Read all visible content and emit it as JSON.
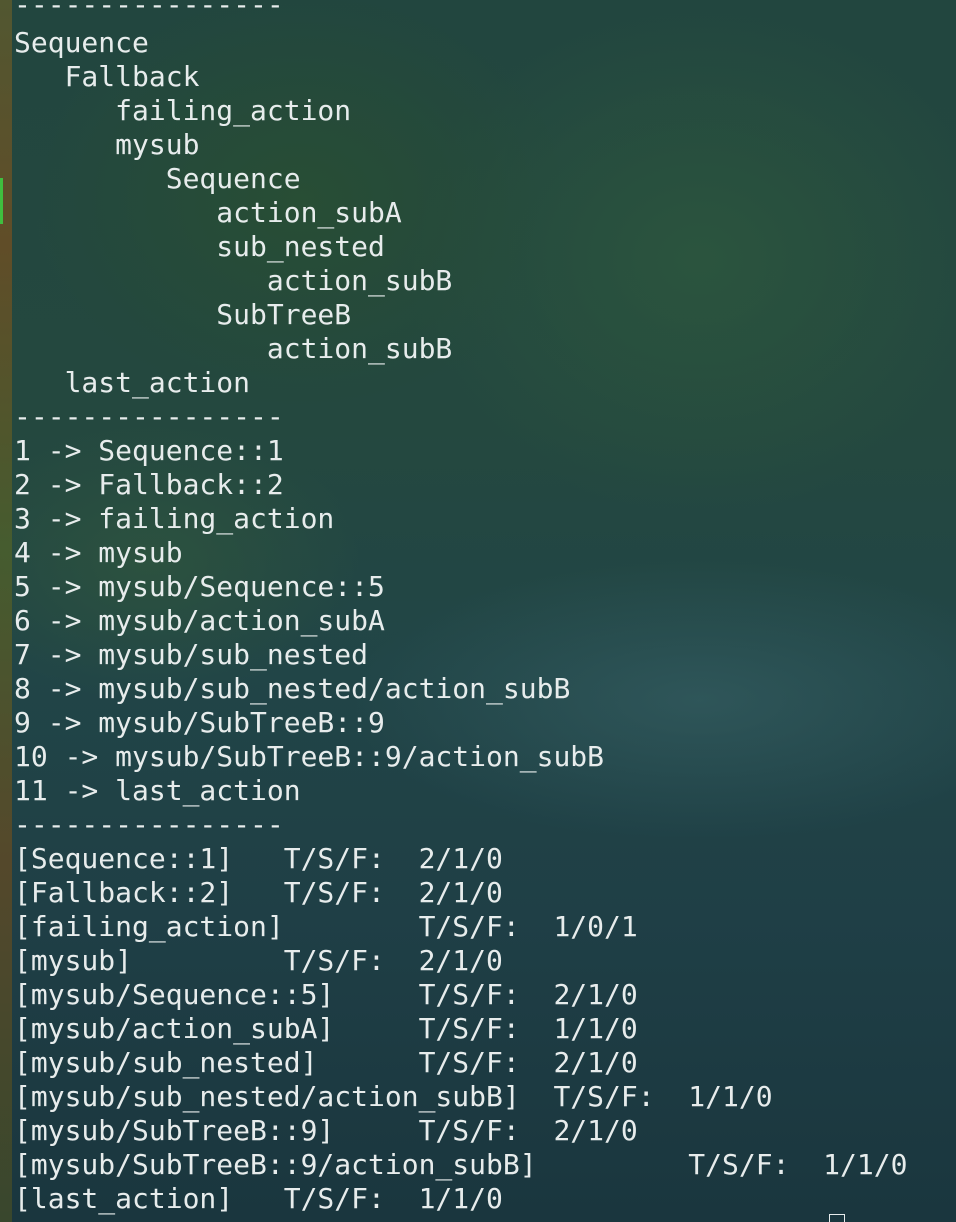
{
  "terminal": {
    "lines": [
      "----------------",
      "Sequence",
      "   Fallback",
      "      failing_action",
      "      mysub",
      "         Sequence",
      "            action_subA",
      "            sub_nested",
      "               action_subB",
      "            SubTreeB",
      "               action_subB",
      "   last_action",
      "----------------",
      "1 -> Sequence::1",
      "2 -> Fallback::2",
      "3 -> failing_action",
      "4 -> mysub",
      "5 -> mysub/Sequence::5",
      "6 -> mysub/action_subA",
      "7 -> mysub/sub_nested",
      "8 -> mysub/sub_nested/action_subB",
      "9 -> mysub/SubTreeB::9",
      "10 -> mysub/SubTreeB::9/action_subB",
      "11 -> last_action",
      "----------------",
      "[Sequence::1]   T/S/F:  2/1/0",
      "[Fallback::2]   T/S/F:  2/1/0",
      "[failing_action]        T/S/F:  1/0/1",
      "[mysub]         T/S/F:  2/1/0",
      "[mysub/Sequence::5]     T/S/F:  2/1/0",
      "[mysub/action_subA]     T/S/F:  1/1/0",
      "[mysub/sub_nested]      T/S/F:  2/1/0",
      "[mysub/sub_nested/action_subB]  T/S/F:  1/1/0",
      "[mysub/SubTreeB::9]     T/S/F:  2/1/0",
      "[mysub/SubTreeB::9/action_subB]         T/S/F:  1/1/0",
      "[last_action]   T/S/F:  1/1/0"
    ]
  },
  "colors": {
    "text": "#e7ecec",
    "background": "#1c3d42",
    "accent": "#3fbf3f"
  }
}
